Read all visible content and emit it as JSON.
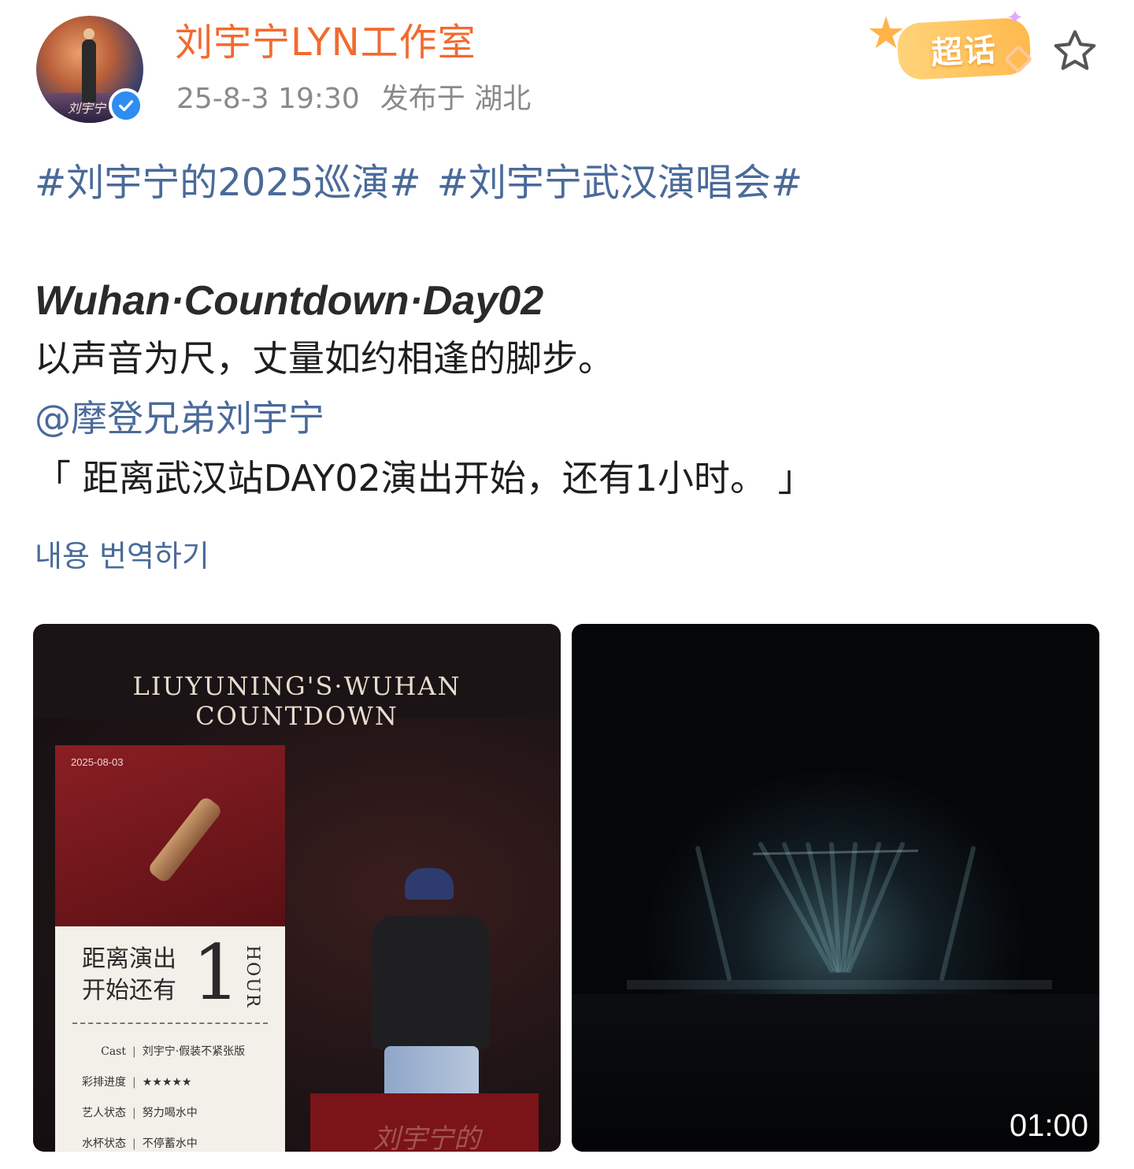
{
  "post": {
    "author": "刘宇宁LYN工作室",
    "avatar_signature": "刘宇宁",
    "timestamp": "25-8-3 19:30",
    "location": "发布于 湖北",
    "supertopic_badge": "超话",
    "topics": [
      "#刘宇宁的2025巡演#",
      "#刘宇宁武汉演唱会#"
    ],
    "headline": "Wuhan·Countdown·Day02",
    "line1": "以声音为尺，丈量如约相逢的脚步。",
    "mention": "@摩登兄弟刘宇宁",
    "line3": "「 距离武汉站DAY02演出开始，还有1小时。 」",
    "translate_link": "내용 번역하기"
  },
  "media": {
    "poster": {
      "title": "LIUYUNING'S·WUHAN COUNTDOWN",
      "date": "2025-08-03",
      "zh_line1": "距离演出",
      "zh_line2": "开始还有",
      "big_number": "1",
      "unit": "HOUR",
      "rows": [
        {
          "key": "Cast",
          "value": "刘宇宁·假装不紧张版"
        },
        {
          "key": "彩排进度",
          "value": "★★★★★"
        },
        {
          "key": "艺人状态",
          "value": "努力喝水中"
        },
        {
          "key": "水杯状态",
          "value": "不停蓄水中"
        }
      ],
      "footer_signature": "刘宇宁的"
    },
    "video": {
      "duration": "01:00"
    }
  },
  "colors": {
    "author": "#f26a2e",
    "link": "#4a6a9a",
    "meta": "#8a8a8a",
    "verified": "#2f8cf0"
  },
  "icons": {
    "verified": "verified-check-icon",
    "favorite": "star-outline-icon",
    "supertopic": "supertopic-badge-icon"
  }
}
